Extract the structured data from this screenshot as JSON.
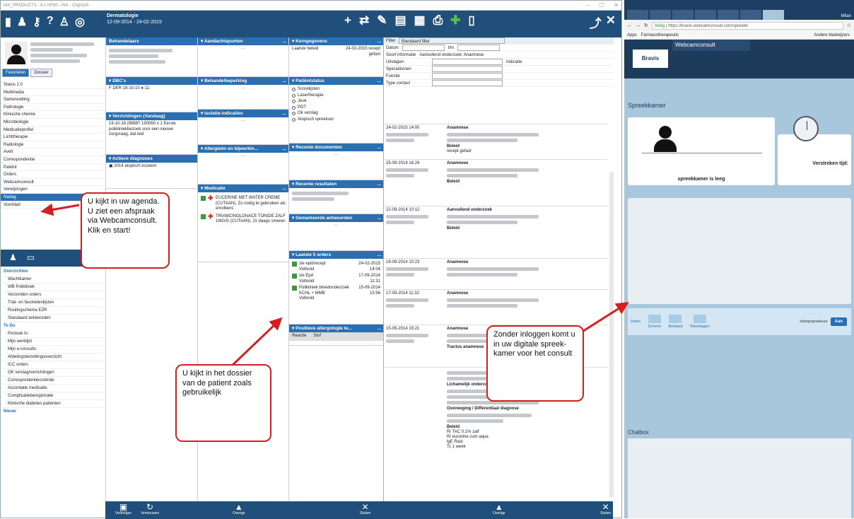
{
  "window": {
    "title": "HiX_PRODUCTS - 6.1 HF80 - HiX - ChipSoft"
  },
  "toolbar": {
    "dept": "Dermatologie",
    "period": "12-09-2014 - 24-02-2015"
  },
  "patient": {
    "tabs": [
      "Favorieten",
      "Dossier"
    ]
  },
  "nav": {
    "items": [
      "Status 2.0",
      "Multimedia",
      "Samenvatting",
      "Pathologie",
      "Klinische chemie",
      "Microbiologie",
      "Medicatieprofiel",
      "Lichttherapie",
      "Radiologie",
      "Avelt",
      "Correspondentie",
      "Patiënt",
      "Orders",
      "Webcamconsult",
      "Verwijzingen",
      "Nadag",
      "Voorblad"
    ],
    "selected": "Nadag"
  },
  "tree": {
    "section1": "Overzichten",
    "items1": [
      "Wachtkamer",
      "WB Polikliniek",
      "Verzonden orders",
      "Trial- en favorietenlijsten",
      "Routingschema EZR",
      "Standaard antwoorden"
    ],
    "section2": "To Do",
    "items2": [
      "Postvak In",
      "Mijn werklijst",
      "Mijn e-consults",
      "Afdelingsbezettingsoverzicht",
      "ICC orders",
      "OK verslag/verrichtingen",
      "Correspondentiecontrole",
      "Accordatie medicatie",
      "Complicatieberegistratie",
      "Klinische diabetes patienten"
    ],
    "section3": "Nieuw"
  },
  "col1": {
    "behandelaars": "Behandelaars",
    "dbc_h": "DBC's",
    "dbc_text": "F  DER  19-10-10",
    "dbc_extra": "11-",
    "verr_h": "Verrichtingen (Vandaag)",
    "verr_text": "19-10-18 (9888? 190060 x 1 Eerste polikliniekbezoek voor een nieuwe zorgvraag, dat leid",
    "diag_h": "Actieve diagnoses",
    "diag_text": "2014 atopisch eczeem"
  },
  "col2": {
    "aandacht": "Aandachtspunten",
    "beperking": "Behandelbeperking",
    "isolatie": "Isolatie-indicaties",
    "allergie": "Allergieën en bijwerkin...",
    "medicatie": "Medicatie",
    "med1": "EUCERINE MET WATER CREME (CUTAAN). Zo nodig te gebruiken als emolliens",
    "med2": "TRIAMCINOLONACE TONIDE ZALF 1MG/G (CUTAAN). 2x daags smeren"
  },
  "col3": {
    "kerngegevens": "Kerngegevens",
    "kern_label": "Laatste beleid",
    "kern_value": "24-02-2015 recept gefaxt",
    "patstatus": "Patiëntstatus",
    "statuses": [
      "Scorelijsten",
      "Lasertherapie",
      "Jeuk",
      "PDT",
      "Ok verslag",
      "Atopisch spreekuur"
    ],
    "docs": "Recente documenten",
    "results": "Recente resultaten",
    "gemarkeerd": "Gemarkeerde antwoorden",
    "orders_h": "Laatste 5 orders",
    "orders": [
      {
        "name": "zie epd/recept",
        "status": "Voltooid",
        "date": "24-02-2015",
        "time": "14:04"
      },
      {
        "name": "zie Epd",
        "status": "Voltooid",
        "date": "17-09-2014",
        "time": "11:31"
      },
      {
        "name": "Polikliniek bloedonderzoek KCHL + MMB",
        "status": "Voltooid",
        "date": "15-09-2014",
        "time": "15:56"
      }
    ],
    "positive": "Positieve allergologie te...",
    "reactie": "Reactie",
    "stof": "Stof"
  },
  "filter": {
    "label": "Filter",
    "value": "Standaard filter",
    "datum": "Datum",
    "tm": "t/m",
    "soort": "Soort informatie",
    "soort_value": "Aanvullend onderzoek; Anamnese",
    "uitslagen": "Uitslagen",
    "indicatie": "Indicatie",
    "specialismen": "Specialismen",
    "functie": "Functie",
    "type": "Type contact"
  },
  "entries": [
    {
      "date": "24-02-2015 14:00",
      "title": "Anamnese",
      "sub": "Beleid",
      "subtext": "recept gefaxt"
    },
    {
      "date": "25-09-2014 16:24",
      "title": "Anamnese",
      "sub": "Beleid",
      "subtext": ""
    },
    {
      "date": "22-09-2014 10:12",
      "title": "Aanvullend onderzoek",
      "sub": "Beleid",
      "subtext": ""
    },
    {
      "date": "18-09-2014 10:23",
      "title": "Anamnese",
      "sub": "",
      "subtext": ""
    },
    {
      "date": "17-09-2014 11:32",
      "title": "Anamnese",
      "sub": "",
      "subtext": ""
    },
    {
      "date": "15-09-2014 15:21",
      "title": "Anamnese",
      "sub": "Tractus anamnese",
      "subtext": ""
    }
  ],
  "lastentry": {
    "lich": "Lichamelijk onderzoek",
    "over": "Overweging / Differentiaal diagnose",
    "beleid": "Beleid",
    "lines": [
      "R/ TAC 0,1% zalf",
      "R/ eucerine cum aqua",
      "lgE Rast",
      "Tc 1 week"
    ]
  },
  "bottom": {
    "b1": "Verbergen",
    "b2": "Vernieuwen",
    "b3": "Overige",
    "b4": "Sluiten",
    "b5": "Overige",
    "b6": "Sluiten"
  },
  "browser": {
    "url": "https://bravis.webcamconsult.com/spreekk",
    "secure": "Veilig",
    "apps": "Apps",
    "bookmark1": "Farmacotherapeutis",
    "bookmark2": "Andere bladwijzers",
    "user": "Milan"
  },
  "webcam": {
    "logo": "Bravis",
    "brand": "Webcamconsult",
    "room_title": "Spreekkamer",
    "room_status": "spreekkamer is leeg",
    "elapsed": "Verstreken tijd:",
    "chat": "Chatbox",
    "controls": [
      "Delen",
      "Scherm",
      "Bestand",
      "Tekenlagen"
    ],
    "toggle_label": "Inloopspreekuur",
    "toggle_value": "Aan"
  },
  "callouts": {
    "c1": "U kijkt in uw agenda. U ziet een afspraak via Webcamconsult. Klik en start!",
    "c2": "U kijkt in het dossier van de patient zoals gebruikelijk",
    "c3": "Zonder inloggen komt u in uw digitale spreek-kamer voor het consult"
  },
  "colors": {
    "accent": "#1f4f7a",
    "header": "#2a6fb0",
    "callout": "#d31f1f"
  }
}
